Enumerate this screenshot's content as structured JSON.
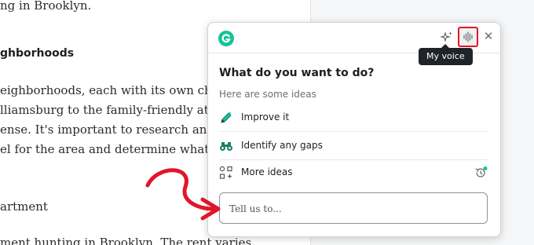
{
  "document": {
    "lines": [
      "ng in Brooklyn.",
      "ghborhoods",
      "eighborhoods, each with its own characte",
      "lliamsburg to the family-friendly atmosp",
      "ense. It's important to research and visit",
      "el for the area and determine what suits",
      "artment",
      "ment hunting in Brooklyn. The rent varies"
    ]
  },
  "assistant": {
    "tooltip": "My voice",
    "heading": "What do you want to do?",
    "subheading": "Here are some ideas",
    "ideas": [
      {
        "label": "Improve it",
        "icon": "pencil-sparkle-icon"
      },
      {
        "label": "Identify any gaps",
        "icon": "binoculars-icon"
      },
      {
        "label": "More ideas",
        "icon": "grid-plus-icon"
      }
    ],
    "input_placeholder": "Tell us to...",
    "colors": {
      "brand": "#15c39a",
      "highlight": "#e0162b",
      "arrow": "#e0162b"
    }
  }
}
